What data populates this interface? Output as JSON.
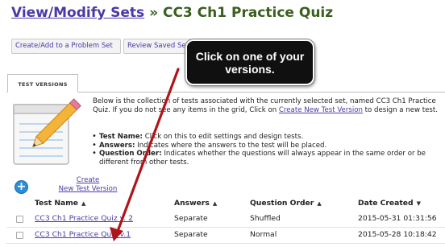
{
  "header": {
    "crumb": "View/Modify Sets",
    "separator": "»",
    "set_name": "CC3 Ch1 Practice Quiz"
  },
  "toolbar": {
    "create_label": "Create/Add to a Problem Set",
    "review_label": "Review Saved Sets"
  },
  "tabs": [
    {
      "label": "TEST VERSIONS",
      "active": true
    }
  ],
  "description": {
    "text1": "Below is the collection of tests associated with the currently selected set, named CC3 Ch1 Practice Quiz. If you do not see any items in the grid, Click on ",
    "link": "Create New Test Version",
    "text2": " to design a new test."
  },
  "bullets": [
    {
      "term": "Test Name:",
      "text": " Click on this to edit settings and design tests."
    },
    {
      "term": "Answers:",
      "text": " Indicates where the answers to the test will be placed."
    },
    {
      "term": "Question Order:",
      "text": " Indicates whether the questions will always appear in the same order or be different from other tests."
    }
  ],
  "create_link": {
    "line1": "Create",
    "line2": "New Test Version"
  },
  "table": {
    "columns": [
      {
        "label": "Test Name",
        "sort": "▲"
      },
      {
        "label": "Answers",
        "sort": "▲"
      },
      {
        "label": "Question Order",
        "sort": "▲"
      },
      {
        "label": "Date Created",
        "sort": "▼"
      }
    ],
    "rows": [
      {
        "name": "CC3 Ch1 Practice Quiz v. 2",
        "answers": "Separate",
        "order": "Shuffled",
        "date": "2015-05-31 01:31:56"
      },
      {
        "name": "CC3 Ch1 Practice Quiz v.1",
        "answers": "Separate",
        "order": "Normal",
        "date": "2015-05-28 10:18:42"
      }
    ]
  },
  "callout": {
    "line1": "Click on one of your",
    "line2": "versions."
  },
  "colors": {
    "link": "#4a3aa8",
    "title": "#3a5f1f",
    "arrow": "#b0141a",
    "add_button": "#2a8fd8"
  },
  "icons": {
    "notepad": "notepad-pencil-icon",
    "add": "plus-circle-icon"
  }
}
